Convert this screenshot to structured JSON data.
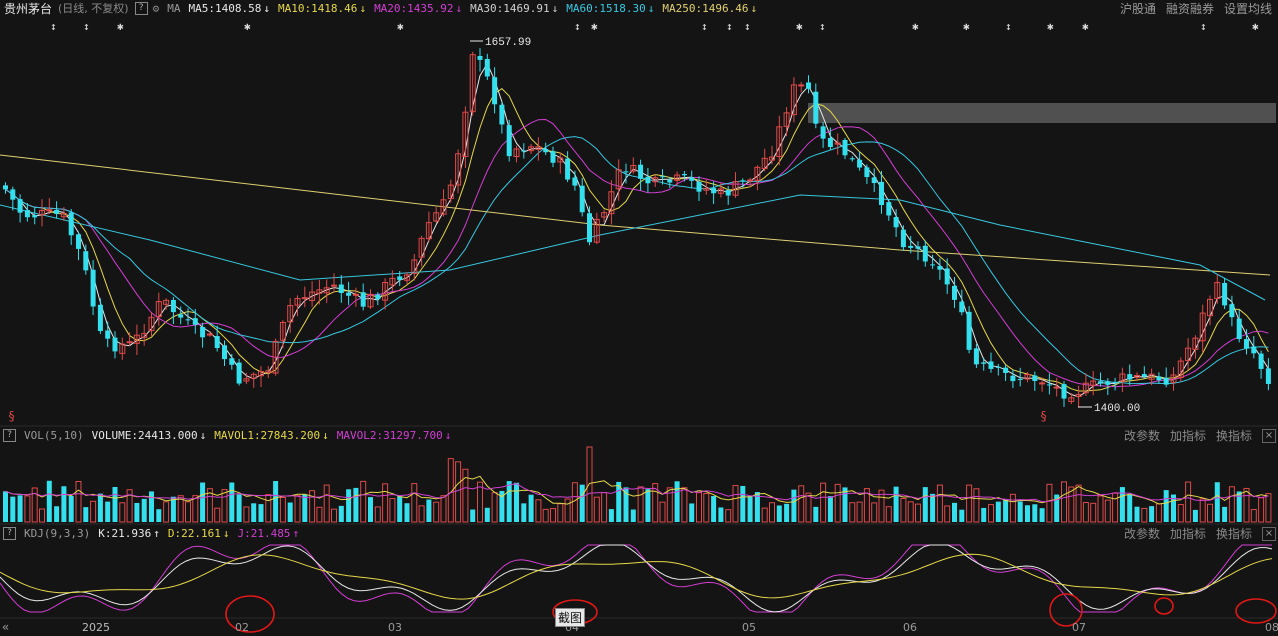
{
  "header": {
    "stock_name": "贵州茅台",
    "mode": "(日线, 不复权)",
    "help": "?",
    "indicator": "MA",
    "ma": [
      {
        "label": "MA5:1408.58",
        "dir": "↓",
        "color": "#e8e8e8"
      },
      {
        "label": "MA10:1418.46",
        "dir": "↓",
        "color": "#e6d84a"
      },
      {
        "label": "MA20:1435.92",
        "dir": "↓",
        "color": "#d23fd2"
      },
      {
        "label": "MA30:1469.91",
        "dir": "↓",
        "color": "#d0d0d0"
      },
      {
        "label": "MA60:1518.30",
        "dir": "↓",
        "color": "#38c7e0"
      },
      {
        "label": "MA250:1496.46",
        "dir": "↓",
        "color": "#e0d070"
      }
    ],
    "links": [
      "沪股通",
      "融资融券",
      "设置均线"
    ]
  },
  "price_chart": {
    "high_label": "1657.99",
    "low_label": "1400.00"
  },
  "volume_panel": {
    "help": "?",
    "name": "VOL(5,10)",
    "volume": "VOLUME:24413.000",
    "volume_dir": "↓",
    "mavol1": "MAVOL1:27843.200",
    "mavol1_dir": "↓",
    "mavol2": "MAVOL2:31297.700",
    "mavol2_dir": "↓",
    "links": [
      "改参数",
      "加指标",
      "换指标"
    ],
    "close": "×"
  },
  "kdj_panel": {
    "help": "?",
    "name": "KDJ(9,3,3)",
    "k": "K:21.936",
    "k_dir": "↑",
    "d": "D:22.161",
    "d_dir": "↓",
    "j": "J:21.485",
    "j_dir": "↑",
    "links": [
      "改参数",
      "加指标",
      "换指标"
    ],
    "close": "×"
  },
  "x_axis": [
    "2025",
    "02",
    "03",
    "04",
    "05",
    "06",
    "07",
    "08"
  ],
  "expand": "«",
  "screenshot_label": "截图",
  "colors": {
    "up": "#e04a4a",
    "down": "#35e0ee",
    "bg": "#141414"
  }
}
